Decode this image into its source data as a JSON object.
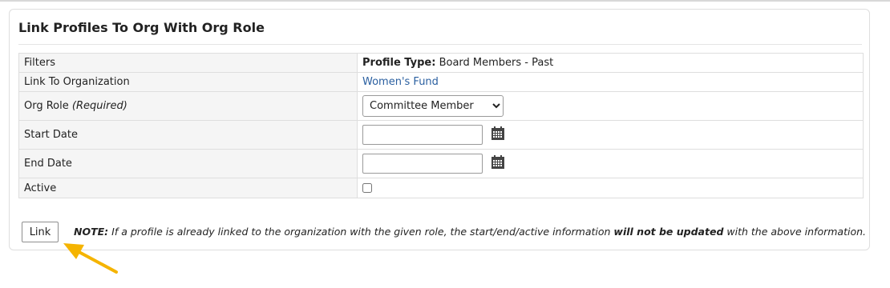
{
  "panel": {
    "title": "Link Profiles To Org With Org Role"
  },
  "rows": {
    "filters": {
      "label": "Filters",
      "key": "Profile Type:",
      "value": "Board Members - Past"
    },
    "link_to_org": {
      "label": "Link To Organization",
      "value": "Women's Fund"
    },
    "org_role": {
      "label": "Org Role",
      "required": "(Required)",
      "selected": "Committee Member"
    },
    "start_date": {
      "label": "Start Date",
      "value": ""
    },
    "end_date": {
      "label": "End Date",
      "value": ""
    },
    "active": {
      "label": "Active",
      "checked": false
    }
  },
  "actions": {
    "link_button": "Link"
  },
  "note": {
    "prefix": "NOTE:",
    "text_1": " If a profile is already linked to the organization with the given role, the start/end/active information ",
    "emphasis": "will not be updated",
    "text_2": " with the above information."
  },
  "colors": {
    "link": "#2a5fa0",
    "arrow": "#f5b400",
    "label_bg": "#f5f5f5"
  },
  "icons": {
    "calendar": "calendar-icon",
    "arrow": "arrow-annotation-icon"
  }
}
